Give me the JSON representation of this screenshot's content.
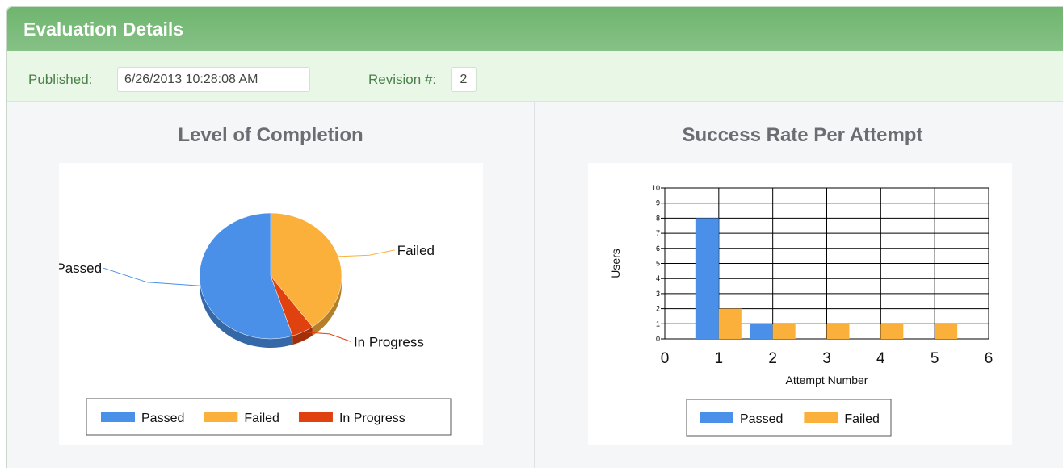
{
  "panel": {
    "title": "Evaluation Details",
    "published_label": "Published:",
    "published_value": "6/26/2013 10:28:08 AM",
    "revision_label": "Revision #:",
    "revision_value": "2"
  },
  "colors": {
    "header": "#76b876",
    "meta_bar": "#e9f7e6",
    "passed": "#4a90e8",
    "failed": "#fbb03b",
    "in_progress": "#e0420f"
  },
  "charts": {
    "completion_title": "Level of Completion",
    "success_title": "Success Rate Per Attempt"
  },
  "chart_data": [
    {
      "type": "pie",
      "title": "Level of Completion",
      "categories": [
        "Passed",
        "Failed",
        "In Progress"
      ],
      "values": [
        55,
        40,
        5
      ],
      "legend": [
        "Passed",
        "Failed",
        "In Progress"
      ],
      "legend_position": "bottom"
    },
    {
      "type": "bar",
      "title": "Success Rate Per Attempt",
      "xlabel": "Attempt Number",
      "ylabel": "Users",
      "xlim": [
        0,
        6
      ],
      "ylim": [
        0,
        10
      ],
      "x_ticks": [
        "0",
        "1",
        "2",
        "3",
        "4",
        "5",
        "6"
      ],
      "y_ticks": [
        "0",
        "1",
        "2",
        "3",
        "4",
        "5",
        "6",
        "7",
        "8",
        "9",
        "10"
      ],
      "categories": [
        1,
        2,
        3,
        4,
        5
      ],
      "series": [
        {
          "name": "Passed",
          "values": [
            8,
            1,
            0,
            0,
            0
          ]
        },
        {
          "name": "Failed",
          "values": [
            2,
            1,
            1,
            1,
            1
          ]
        }
      ],
      "grid": true,
      "legend_position": "bottom"
    }
  ]
}
